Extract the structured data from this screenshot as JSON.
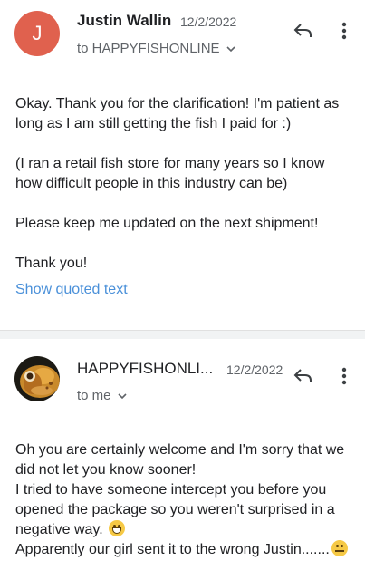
{
  "messages": [
    {
      "avatar_letter": "J",
      "avatar_color": "#e0614e",
      "sender": "Justin Wallin",
      "date": "12/2/2022",
      "recipient": "to HAPPYFISHONLINE",
      "icons": {
        "reply": "reply-icon",
        "more": "more-vert-icon",
        "expand": "chevron-down-icon"
      },
      "paragraphs": [
        "Okay. Thank you for the clarification! I'm patient as long as I am still getting the fish I paid for :)",
        "(I ran a retail fish store for many years so I know how difficult people in this industry can be)",
        "Please keep me updated on the next shipment!",
        "Thank you!"
      ],
      "show_quoted": "Show quoted text"
    },
    {
      "avatar": "fish-photo-avatar",
      "sender": "HAPPYFISHONLI...",
      "date": "12/2/2022",
      "recipient": "to me",
      "icons": {
        "reply": "reply-icon",
        "more": "more-vert-icon",
        "expand": "chevron-down-icon"
      },
      "lines": [
        "Oh you are certainly welcome and I'm sorry that we did not let you know sooner!",
        "I tried to have someone intercept you before you opened the package so you weren't surprised in a negative way.",
        "Apparently our girl sent it to the wrong Justin......."
      ],
      "emojis": [
        "grinning-face-emoji",
        "slightly-smiling-face-emoji"
      ]
    }
  ],
  "colors": {
    "link": "#4a90d9",
    "secondary_text": "#5f6368",
    "divider": "#f1f3f4"
  }
}
